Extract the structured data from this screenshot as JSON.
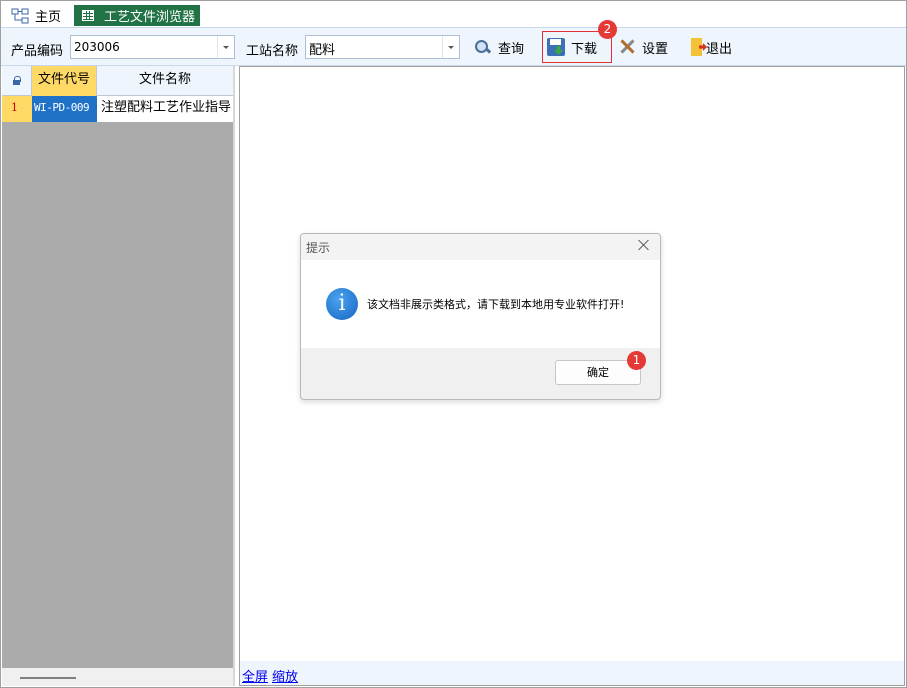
{
  "tabs": [
    {
      "label": "主页",
      "icon": "sitemap-icon"
    },
    {
      "label": "工艺文件浏览器",
      "icon": "table-icon"
    }
  ],
  "toolbar": {
    "product_code_label": "产品编码",
    "product_code_value": "203006",
    "station_label": "工站名称",
    "station_value": "配料",
    "query_label": "查询",
    "download_label": "下载",
    "settings_label": "设置",
    "exit_label": "退出"
  },
  "grid": {
    "columns": [
      "文件代号",
      "文件名称"
    ],
    "rows": [
      {
        "num": "1",
        "code": "WI-PD-009",
        "name": "注塑配料工艺作业指导"
      }
    ]
  },
  "bottom_links": {
    "fullscreen": "全屏",
    "zoom": "缩放"
  },
  "dialog": {
    "title": "提示",
    "message": "该文档非展示类格式，请下载到本地用专业软件打开!",
    "ok_label": "确定"
  },
  "badges": {
    "ok": "1",
    "download": "2"
  },
  "colors": {
    "accent_tab": "#217346",
    "header_highlight": "#ffd966",
    "selected_cell": "#1f72c8",
    "badge": "#e53935"
  }
}
